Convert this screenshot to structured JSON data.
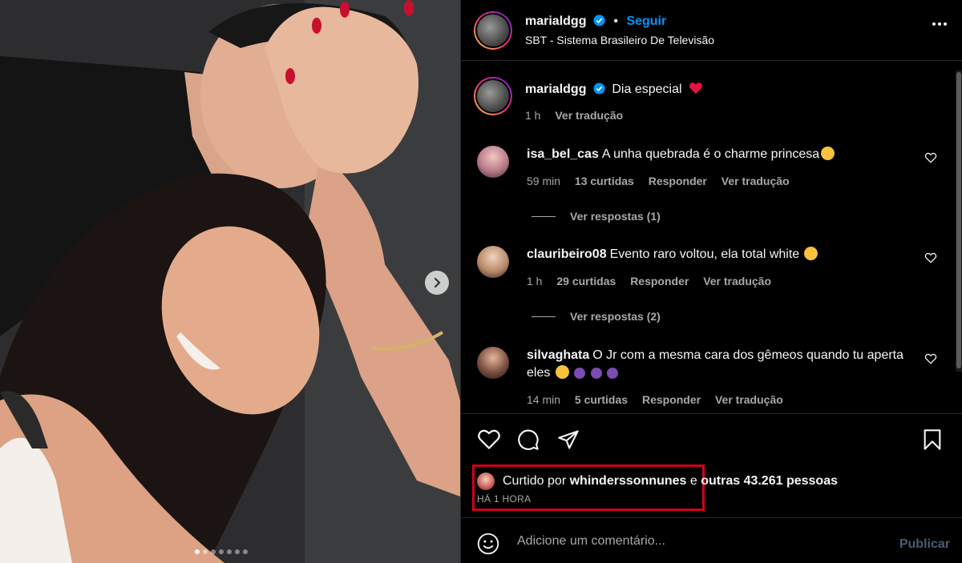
{
  "post": {
    "author": "marialdgg",
    "follow_label": "Seguir",
    "location": "SBT - Sistema Brasileiro De Televisão",
    "caption": "Dia especial",
    "caption_emoji": "heart-emoji",
    "caption_time": "1 h",
    "translate_label": "Ver tradução"
  },
  "comments": [
    {
      "user": "isa_bel_cas",
      "text": "A unha quebrada é o charme princesa",
      "emoji": [
        "heart-eyes-emoji"
      ],
      "time": "59 min",
      "likes": "13 curtidas",
      "reply": "Responder",
      "translate": "Ver tradução",
      "replies": "Ver respostas (1)"
    },
    {
      "user": "clauribeiro08",
      "text": "Evento raro voltou, ela total white",
      "emoji": [
        "heart-eyes-emoji"
      ],
      "time": "1 h",
      "likes": "29 curtidas",
      "reply": "Responder",
      "translate": "Ver tradução",
      "replies": "Ver respostas (2)"
    },
    {
      "user": "silvaghata",
      "text": "O Jr com a mesma cara dos gêmeos quando tu aperta eles",
      "emoji": [
        "laughing-emoji",
        "speaking-head-emoji",
        "speaking-head-emoji",
        "speaking-head-emoji"
      ],
      "time": "14 min",
      "likes": "5 curtidas",
      "reply": "Responder",
      "translate": "Ver tradução"
    }
  ],
  "likes": {
    "prefix": "Curtido por",
    "user": "whinderssonnunes",
    "joiner": "e",
    "others": "outras 43.261 pessoas",
    "time_ago": "HÁ 1 HORA"
  },
  "add_comment": {
    "placeholder": "Adicione um comentário...",
    "publish": "Publicar"
  },
  "carousel": {
    "slides": 7,
    "current": 1
  },
  "colors": {
    "background": "#000000",
    "text": "#f5f5f5",
    "muted": "#a8a8a8",
    "link": "#0095f6",
    "highlight_box": "#d0021b",
    "verified": "#0095f6",
    "heart": "#ff3040"
  }
}
